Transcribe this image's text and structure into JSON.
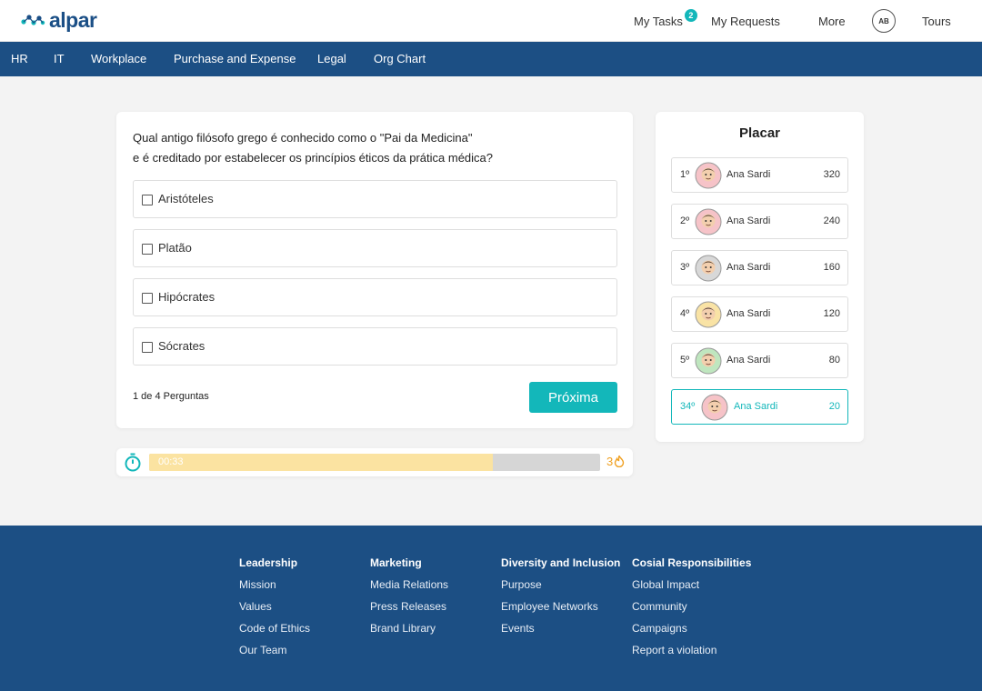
{
  "header": {
    "logo_text": "alpar",
    "nav": {
      "my_tasks": "My Tasks",
      "my_tasks_badge": "2",
      "my_requests": "My Requests",
      "more": "More",
      "avatar_initials": "AB",
      "tours": "Tours"
    }
  },
  "main_nav": [
    "HR",
    "IT",
    "Workplace",
    "Purchase and Expense",
    "Legal",
    "Org Chart"
  ],
  "quiz": {
    "question_line1": "Qual antigo filósofo grego é conhecido como o \"Pai da Medicina\"",
    "question_line2": "e é creditado por estabelecer os princípios éticos da prática médica?",
    "options": [
      "Aristóteles",
      "Platão",
      "Hipócrates",
      "Sócrates"
    ],
    "progress_text": "1 de 4 Perguntas",
    "next_label": "Próxima"
  },
  "timer": {
    "time_text": "00:33",
    "fill_fraction": 0.763,
    "streak": "3"
  },
  "leaderboard": {
    "title": "Placar",
    "rows": [
      {
        "rank": "1º",
        "name": "Ana Sardi",
        "score": "320",
        "avatar": "avatar-man-beard-icon",
        "bg": "#f6c3c8"
      },
      {
        "rank": "2º",
        "name": "Ana Sardi",
        "score": "240",
        "avatar": "avatar-woman-hat-icon",
        "bg": "#f6c3c8"
      },
      {
        "rank": "3º",
        "name": "Ana Sardi",
        "score": "160",
        "avatar": "avatar-elder-icon",
        "bg": "#d8d8d8"
      },
      {
        "rank": "4º",
        "name": "Ana Sardi",
        "score": "120",
        "avatar": "avatar-woman-cap-icon",
        "bg": "#f9e3a5"
      },
      {
        "rank": "5º",
        "name": "Ana Sardi",
        "score": "80",
        "avatar": "avatar-man-icon",
        "bg": "#bfe6bf"
      },
      {
        "rank": "34º",
        "name": "Ana Sardi",
        "score": "20",
        "avatar": "avatar-woman-icon",
        "bg": "#f6c3c8"
      }
    ]
  },
  "footer": {
    "columns": [
      {
        "heading": "Leadership",
        "links": [
          "Mission",
          "Values",
          "Code of Ethics",
          "Our Team"
        ]
      },
      {
        "heading": "Marketing",
        "links": [
          "Media Relations",
          "Press Releases",
          "Brand Library"
        ]
      },
      {
        "heading": "Diversity and Inclusion",
        "links": [
          "Purpose",
          "Employee Networks",
          "Events"
        ]
      },
      {
        "heading": "Cosial Responsibilities",
        "links": [
          "Global Impact",
          "Community",
          "Campaigns",
          "Report a violation"
        ]
      }
    ]
  },
  "colors": {
    "brand_blue": "#1c4f84",
    "accent_teal": "#13b7ba",
    "timer_fill": "#fbe3a1",
    "streak_orange": "#f0a021"
  }
}
